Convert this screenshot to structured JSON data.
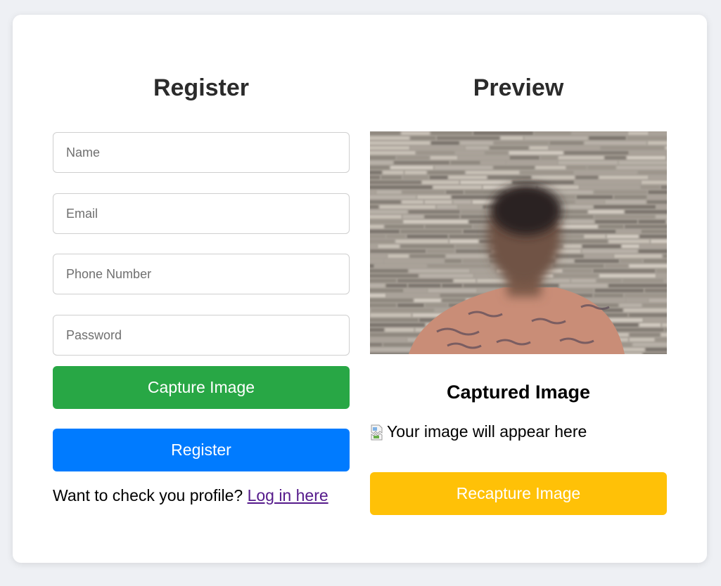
{
  "register": {
    "heading": "Register",
    "fields": {
      "name_placeholder": "Name",
      "email_placeholder": "Email",
      "phone_placeholder": "Phone Number",
      "password_placeholder": "Password"
    },
    "capture_button_label": "Capture Image",
    "register_button_label": "Register",
    "login_prompt": "Want to check you profile?",
    "login_link_label": "Log in here"
  },
  "preview": {
    "heading": "Preview",
    "captured_title": "Captured Image",
    "image_alt_text": "Your image will appear here",
    "recapture_button_label": "Recapture Image"
  },
  "colors": {
    "capture_button": "#28a745",
    "register_button": "#007bff",
    "recapture_button": "#ffc107",
    "page_background": "#eef0f4"
  },
  "icons": {
    "broken_image": "broken-image-icon"
  }
}
